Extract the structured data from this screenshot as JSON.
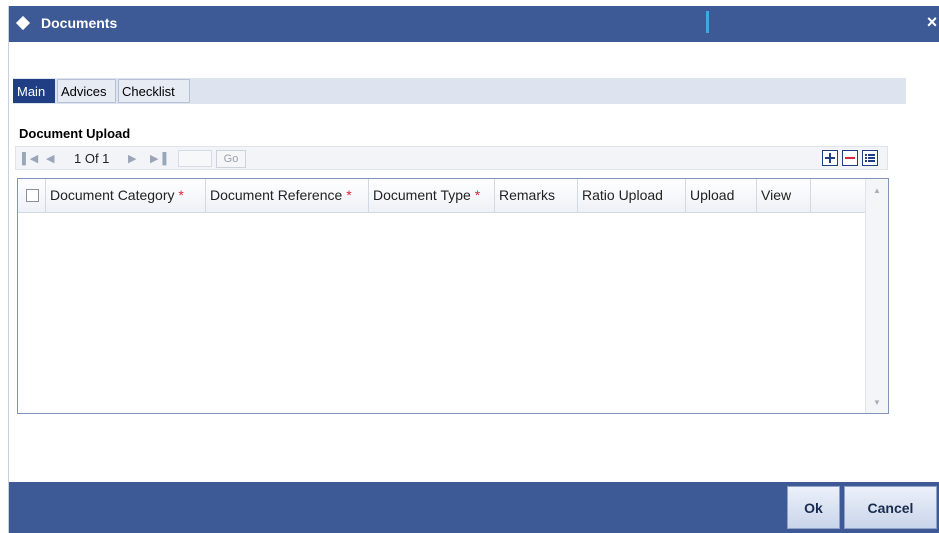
{
  "window": {
    "title": "Documents",
    "close_label": "×"
  },
  "tabs": [
    {
      "label": "Main",
      "active": true
    },
    {
      "label": "Advices",
      "active": false
    },
    {
      "label": "Checklist",
      "active": false
    }
  ],
  "section": {
    "title": "Document Upload"
  },
  "pagination": {
    "page_info": "1 Of 1",
    "go_label": "Go",
    "first_icon": "first-page-icon",
    "prev_icon": "previous-page-icon",
    "next_icon": "next-page-icon",
    "last_icon": "last-page-icon"
  },
  "grid": {
    "columns": [
      {
        "label": "Document Category",
        "required": true
      },
      {
        "label": "Document Reference",
        "required": true
      },
      {
        "label": "Document Type",
        "required": true
      },
      {
        "label": "Remarks",
        "required": false
      },
      {
        "label": "Ratio Upload",
        "required": false
      },
      {
        "label": "Upload",
        "required": false
      },
      {
        "label": "View",
        "required": false
      }
    ],
    "required_mark": "*",
    "rows": []
  },
  "footer": {
    "ok_label": "Ok",
    "cancel_label": "Cancel"
  },
  "colors": {
    "titlebar": "#3d5a96",
    "active_tab": "#1f3e84",
    "required": "#d9263c"
  }
}
